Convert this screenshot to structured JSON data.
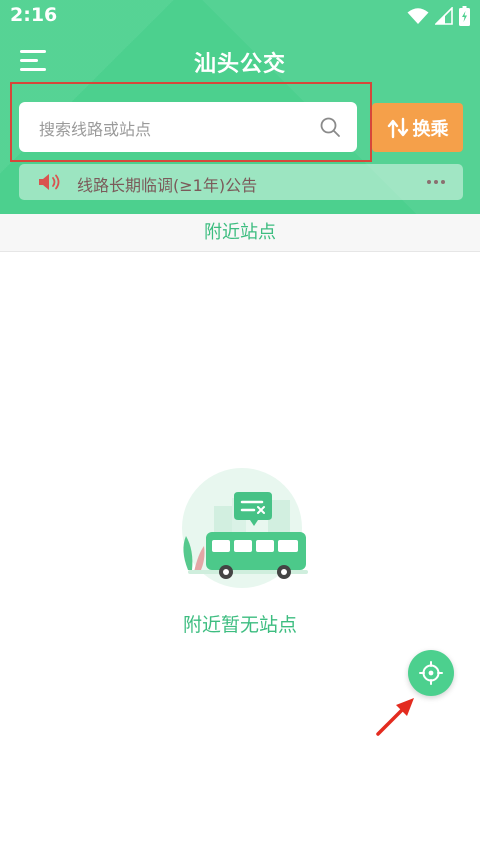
{
  "status_bar": {
    "time": "2:16"
  },
  "nav": {
    "title": "汕头公交"
  },
  "search": {
    "placeholder": "搜索线路或站点"
  },
  "transfer": {
    "label": "换乘"
  },
  "notice": {
    "text": "线路长期临调(≥1年)公告"
  },
  "section": {
    "tab_label": "附近站点"
  },
  "empty": {
    "message": "附近暂无站点"
  },
  "colors": {
    "primary": "#4cd08e",
    "accent_orange": "#f5a04a",
    "highlight_red": "#d6473a",
    "text_green": "#3dbd80"
  },
  "icons": {
    "menu": "hamburger-menu-icon",
    "search": "search-icon",
    "transfer": "transfer-arrows-icon",
    "notice": "speaker-icon",
    "more": "more-dots-icon",
    "locate": "crosshair-locate-icon"
  }
}
